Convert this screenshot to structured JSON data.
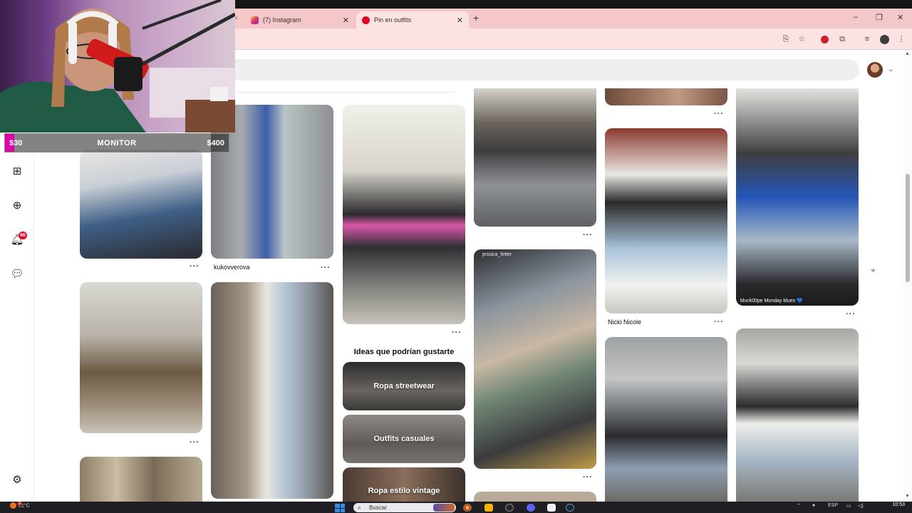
{
  "browser": {
    "tabs": [
      {
        "title": "(7) Instagram",
        "icon": "instagram-icon",
        "active": false
      },
      {
        "title": "Pin en outfits",
        "icon": "pinterest-icon",
        "active": true
      }
    ],
    "new_tab_label": "+",
    "close_glyph": "✕",
    "window_controls": {
      "minimize": "–",
      "maximize": "❐",
      "close": "✕"
    }
  },
  "overlay": {
    "goal_min": "$30",
    "goal_label": "MONITOR",
    "goal_max": "$400",
    "progress_fraction": 0.04,
    "accent_color": "#e000a8"
  },
  "sidebar": {
    "icons": [
      "boards-icon",
      "create-icon",
      "notifications-icon",
      "messages-icon",
      "settings-icon"
    ],
    "notification_count": "66"
  },
  "pins": {
    "captions": {
      "kukov": "kukovverova",
      "nicki": "Nicki Nicole",
      "blvck": "blvck00pe Monday blues 💙",
      "jessica": "jessica_fetter"
    },
    "more_glyph": "···"
  },
  "ideas": {
    "title": "Ideas que podrían gustarte",
    "items": [
      "Ropa streetwear",
      "Outfits casuales",
      "Ropa estilo vintage"
    ]
  },
  "taskbar": {
    "weather": "21°C",
    "weather_badge": "2",
    "search_placeholder": "Buscar",
    "language": "ESP",
    "time": "10:53"
  },
  "colors": {
    "tab_bar": "#f4c7c9",
    "pinterest_red": "#e60023",
    "taskbar": "#1f1f23"
  }
}
